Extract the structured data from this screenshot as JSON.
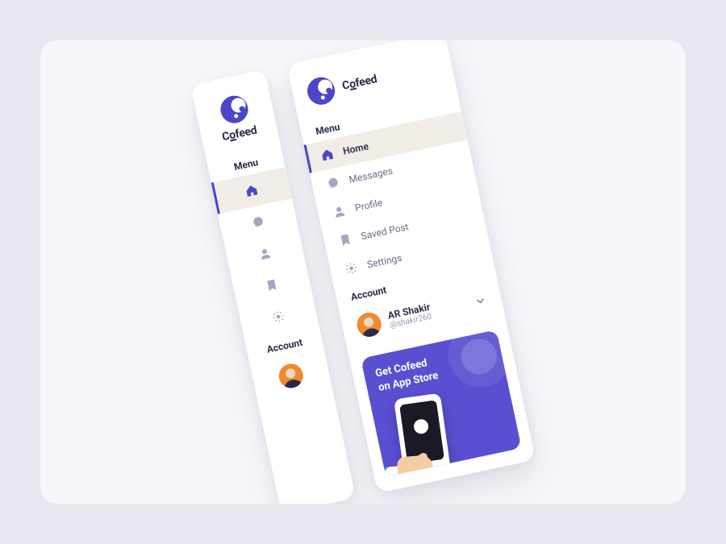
{
  "brand": {
    "name_prefix": "C",
    "name_underlined": "o",
    "name_suffix": "feed"
  },
  "sections": {
    "menu": "Menu",
    "account": "Account"
  },
  "menu": {
    "items": [
      {
        "key": "home",
        "label": "Home",
        "icon": "home-icon",
        "active": true
      },
      {
        "key": "messages",
        "label": "Messages",
        "icon": "messages-icon",
        "active": false
      },
      {
        "key": "profile",
        "label": "Profile",
        "icon": "profile-icon",
        "active": false
      },
      {
        "key": "saved-post",
        "label": "Saved Post",
        "icon": "bookmark-icon",
        "active": false
      },
      {
        "key": "settings",
        "label": "Settings",
        "icon": "settings-icon",
        "active": false
      }
    ]
  },
  "account": {
    "name": "AR Shakir",
    "handle": "@shakir260"
  },
  "promo": {
    "line1": "Get Cofeed",
    "line2": "on App Store"
  },
  "colors": {
    "accent": "#4a47c9",
    "promoBg": "#5a4fd1",
    "avatarBg": "#f08a2c",
    "activeBg": "#f2ede7"
  }
}
